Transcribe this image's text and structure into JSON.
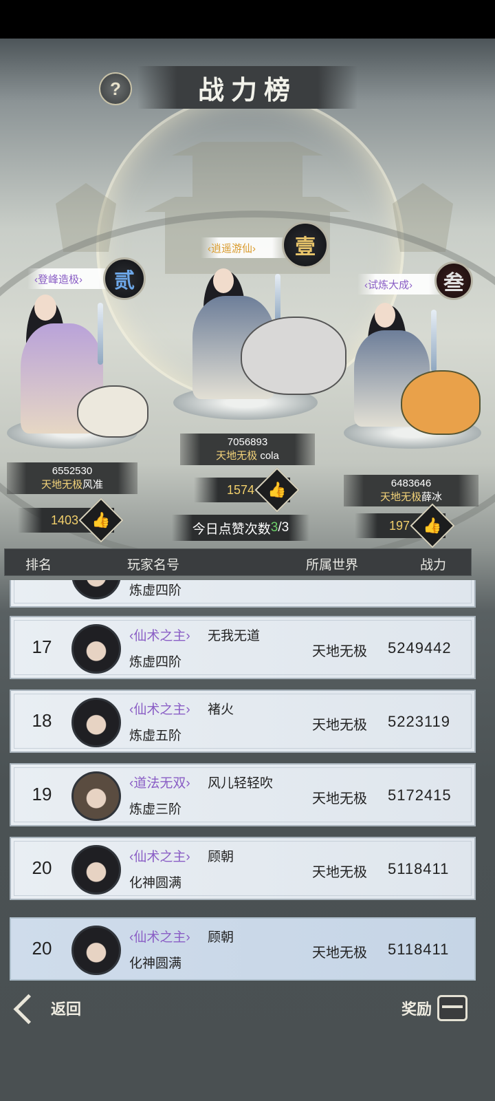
{
  "page_title": "战力榜",
  "help_icon_text": "?",
  "top3": [
    {
      "rank_char": "贰",
      "title": "‹登峰造极›",
      "title_color": "#8a5ec5",
      "power": "6552530",
      "world": "天地无极",
      "name": "风准",
      "likes": "1403"
    },
    {
      "rank_char": "壹",
      "title": "‹逍遥游仙›",
      "title_color": "#d99a2b",
      "power": "7056893",
      "world": "天地无极",
      "name": "cola",
      "likes": "1574"
    },
    {
      "rank_char": "叁",
      "title": "‹试炼大成›",
      "title_color": "#8a5ec5",
      "power": "6483646",
      "world": "天地无极",
      "name": "薛冰",
      "likes": "197"
    }
  ],
  "like_icon": "thumbs-up-icon",
  "today_likes": {
    "label": "今日点赞次数",
    "used": "3",
    "total": "/3"
  },
  "columns": {
    "rank": "排名",
    "player": "玩家名号",
    "world": "所属世界",
    "power": "战力"
  },
  "partial_row": {
    "stage": "炼虚四阶"
  },
  "rows": [
    {
      "rank": "17",
      "title": "‹仙术之主›",
      "name": "无我无道",
      "stage": "炼虚四阶",
      "world": "天地无极",
      "power": "5249442"
    },
    {
      "rank": "18",
      "title": "‹仙术之主›",
      "name": "褚火",
      "stage": "炼虚五阶",
      "world": "天地无极",
      "power": "5223119"
    },
    {
      "rank": "19",
      "title": "‹道法无双›",
      "name": "风儿轻轻吹",
      "stage": "炼虚三阶",
      "world": "天地无极",
      "power": "5172415"
    },
    {
      "rank": "20",
      "title": "‹仙术之主›",
      "name": "顾朝",
      "stage": "化神圆满",
      "world": "天地无极",
      "power": "5118411"
    }
  ],
  "my_row": {
    "rank": "20",
    "title": "‹仙术之主›",
    "name": "顾朝",
    "stage": "化神圆满",
    "world": "天地无极",
    "power": "5118411"
  },
  "bottom": {
    "back_label": "返回",
    "reward_label": "奖励"
  }
}
